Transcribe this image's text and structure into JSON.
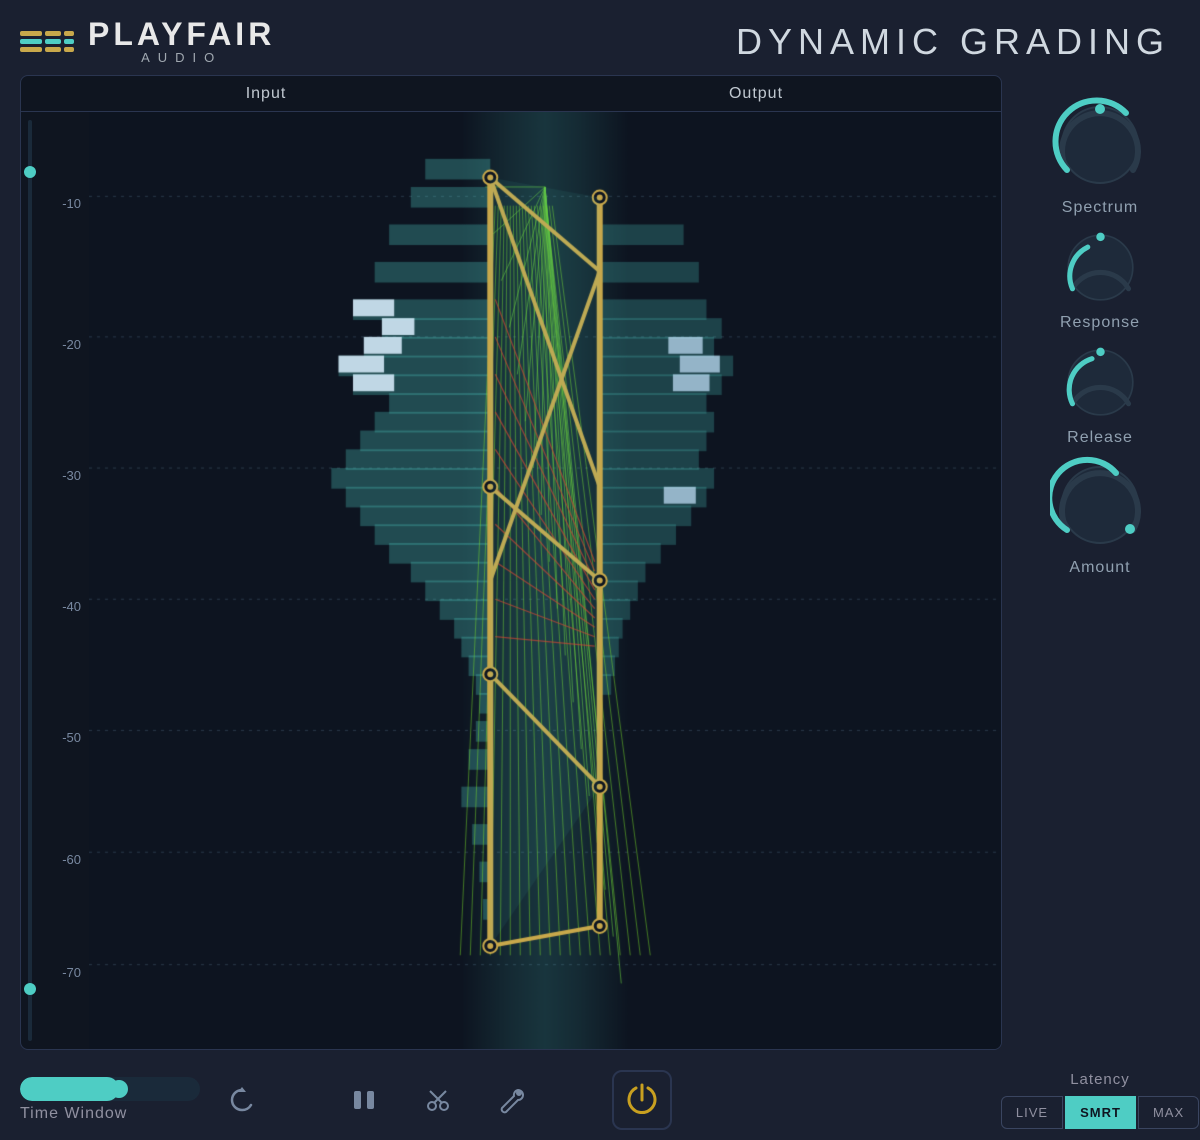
{
  "header": {
    "app_name": "PLAYFAIR",
    "app_sub": "AUDIO",
    "title": "DYNAMIC GRADING"
  },
  "analyzer": {
    "input_label": "Input",
    "output_label": "Output",
    "db_markers": [
      {
        "value": "-10",
        "pct": 10
      },
      {
        "value": "-20",
        "pct": 25
      },
      {
        "value": "-30",
        "pct": 40
      },
      {
        "value": "-40",
        "pct": 55
      },
      {
        "value": "-50",
        "pct": 70
      },
      {
        "value": "-60",
        "pct": 82
      },
      {
        "value": "-70",
        "pct": 94
      }
    ]
  },
  "knobs": [
    {
      "id": "spectrum",
      "label": "Spectrum",
      "value": 0.75,
      "arc_start": 225,
      "arc_end": 315
    },
    {
      "id": "response",
      "label": "Response",
      "value": 0.3,
      "arc_start": 225,
      "arc_end": 315
    },
    {
      "id": "release",
      "label": "Release",
      "value": 0.4,
      "arc_start": 225,
      "arc_end": 315
    },
    {
      "id": "amount",
      "label": "Amount",
      "value": 0.65,
      "arc_start": 225,
      "arc_end": 315
    }
  ],
  "bottom": {
    "time_window_label": "Time Window",
    "time_window_pct": 55,
    "reset_icon": "↺",
    "icons": [
      "ii",
      "✕",
      "🔧"
    ],
    "latency": {
      "label": "Latency",
      "buttons": [
        {
          "label": "LIVE",
          "active": false
        },
        {
          "label": "SMRT",
          "active": true
        },
        {
          "label": "MAX",
          "active": false
        }
      ]
    }
  },
  "colors": {
    "accent": "#4ecdc4",
    "gold": "#c8a84b",
    "dark_bg": "#0f1520",
    "panel_bg": "#1a2030",
    "text_muted": "#9090a0"
  }
}
